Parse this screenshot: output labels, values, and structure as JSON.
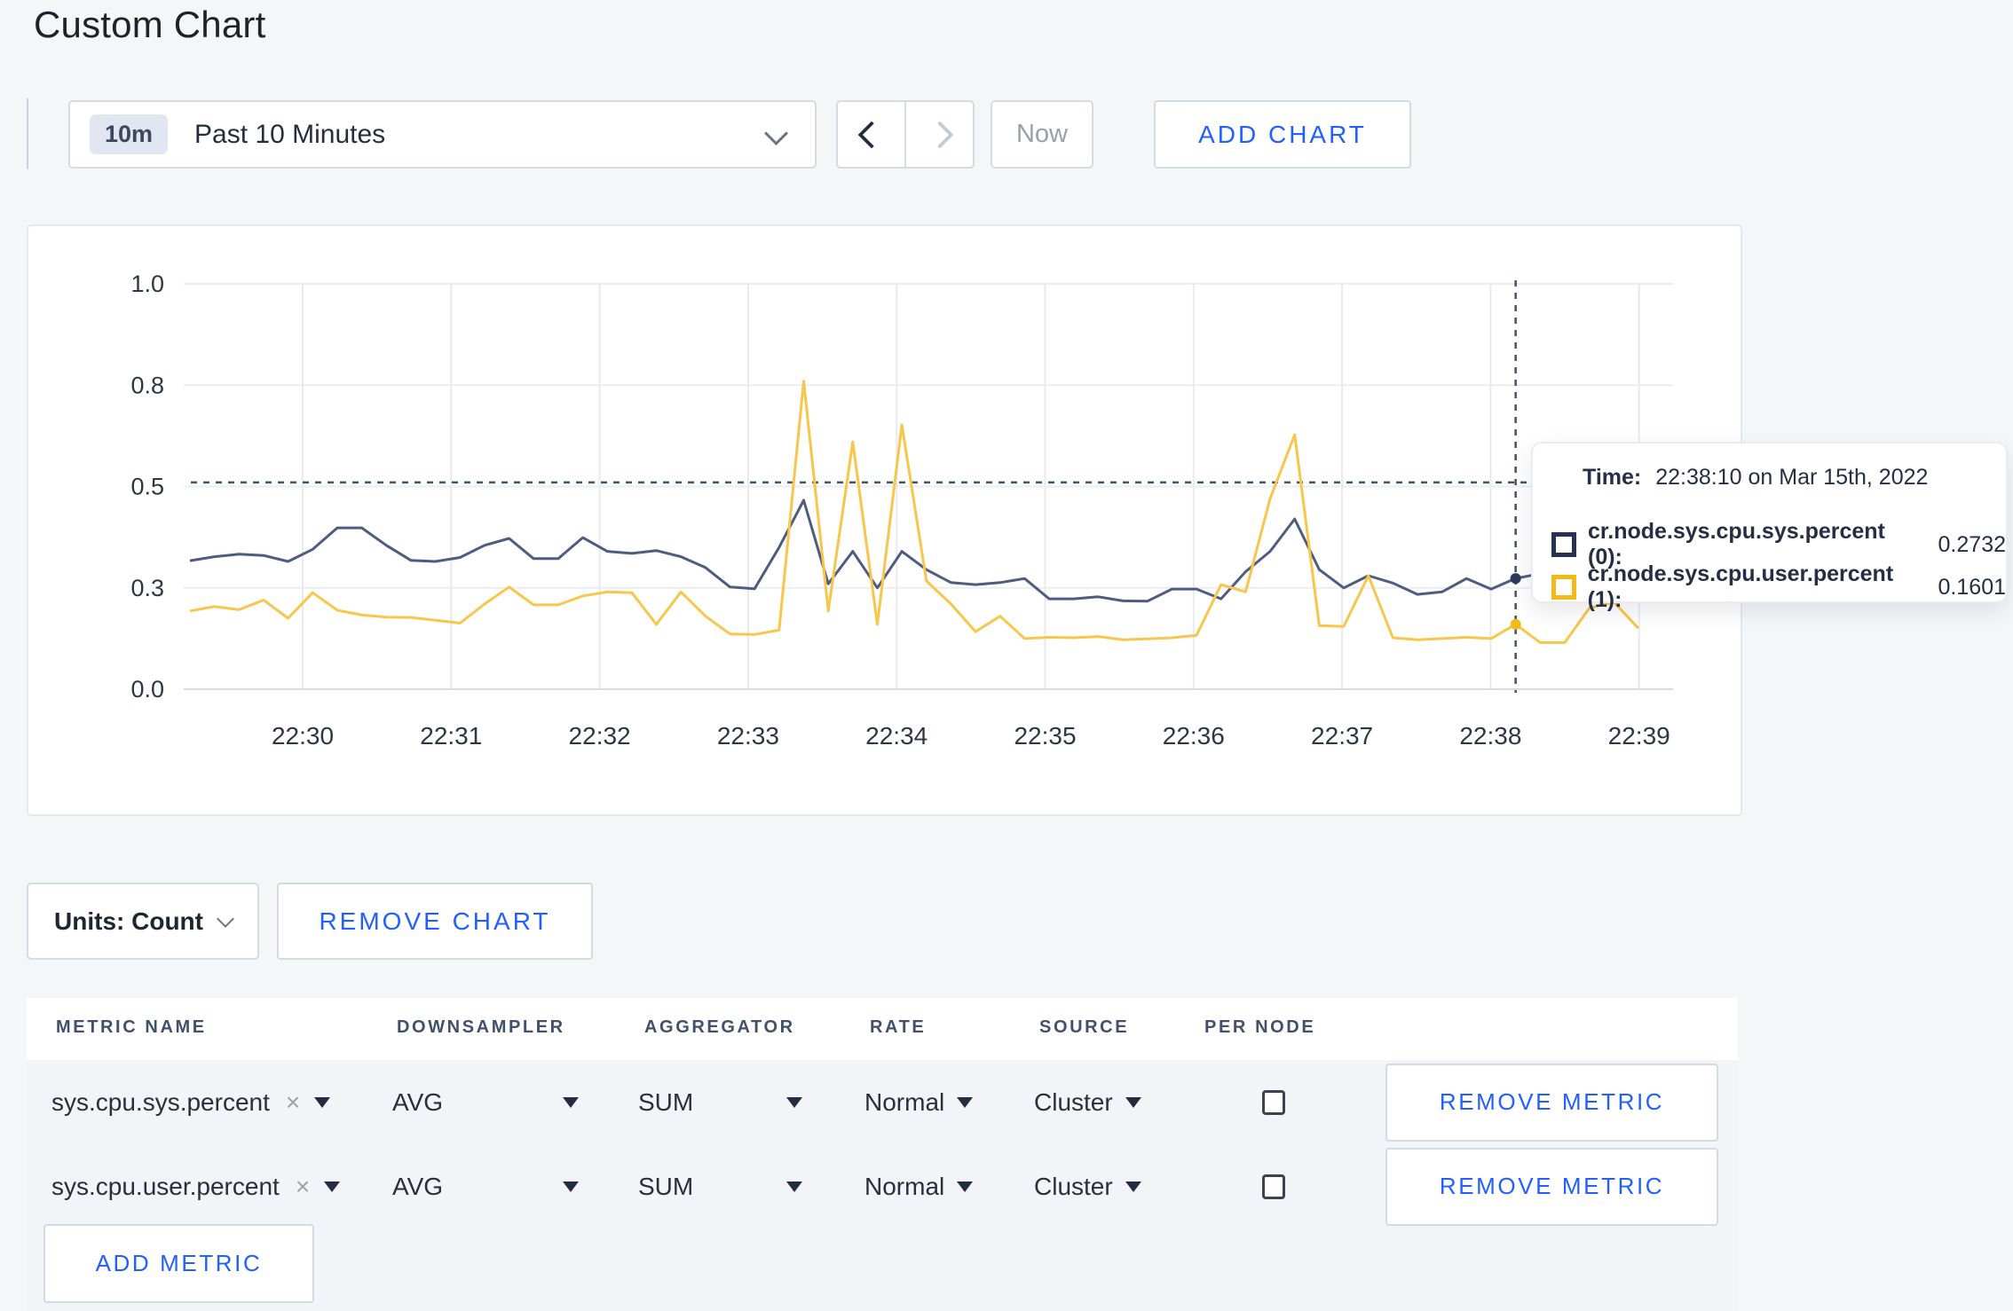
{
  "page": {
    "title": "Custom Chart",
    "accent_blue": "#2160ff",
    "background": "#f5f6f8"
  },
  "toolbar": {
    "time_window_badge": "10m",
    "time_window_label": "Past 10 Minutes",
    "prev_tooltip": "previous time window",
    "next_tooltip": "next time window",
    "now_label": "Now",
    "add_chart_label": "ADD CHART"
  },
  "chart_data": {
    "type": "line",
    "title": "",
    "xlabel": "",
    "ylabel": "",
    "ylim": [
      0,
      1
    ],
    "grid": true,
    "x_start_time": "22:29:10",
    "x_interval_seconds": 10,
    "x_tick_labels": [
      "22:30",
      "22:31",
      "22:32",
      "22:33",
      "22:34",
      "22:35",
      "22:36",
      "22:37",
      "22:38",
      "22:39"
    ],
    "y_ticks": [
      {
        "value": 0.0,
        "label": "0.0"
      },
      {
        "value": 0.25,
        "label": "0.3"
      },
      {
        "value": 0.5,
        "label": "0.5"
      },
      {
        "value": 0.75,
        "label": "0.8"
      },
      {
        "value": 1.0,
        "label": "1.0"
      }
    ],
    "series": [
      {
        "name": "cr.node.sys.cpu.sys.percent (0)",
        "color": "#4d5c80",
        "values": [
          0.317,
          0.327,
          0.333,
          0.33,
          0.315,
          0.345,
          0.398,
          0.398,
          0.355,
          0.318,
          0.315,
          0.325,
          0.355,
          0.372,
          0.322,
          0.322,
          0.374,
          0.34,
          0.335,
          0.342,
          0.327,
          0.3,
          0.252,
          0.248,
          0.35,
          0.466,
          0.26,
          0.34,
          0.25,
          0.34,
          0.295,
          0.263,
          0.258,
          0.263,
          0.273,
          0.223,
          0.223,
          0.228,
          0.218,
          0.217,
          0.247,
          0.247,
          0.223,
          0.29,
          0.34,
          0.42,
          0.295,
          0.25,
          0.28,
          0.262,
          0.234,
          0.24,
          0.273,
          0.247,
          0.2732,
          0.285,
          0.272,
          0.28,
          0.268,
          0.295
        ]
      },
      {
        "name": "cr.node.sys.cpu.user.percent (1)",
        "color": "#f8c64a",
        "values": [
          0.193,
          0.204,
          0.196,
          0.22,
          0.175,
          0.238,
          0.195,
          0.183,
          0.178,
          0.177,
          0.17,
          0.163,
          0.21,
          0.252,
          0.208,
          0.208,
          0.23,
          0.24,
          0.238,
          0.16,
          0.24,
          0.18,
          0.136,
          0.135,
          0.146,
          0.76,
          0.193,
          0.61,
          0.16,
          0.652,
          0.267,
          0.21,
          0.142,
          0.18,
          0.125,
          0.128,
          0.127,
          0.13,
          0.122,
          0.124,
          0.127,
          0.133,
          0.258,
          0.24,
          0.47,
          0.628,
          0.157,
          0.155,
          0.28,
          0.127,
          0.122,
          0.125,
          0.128,
          0.125,
          0.1601,
          0.115,
          0.115,
          0.2,
          0.215,
          0.15
        ]
      }
    ],
    "crosshair": {
      "index": 54,
      "time": "22:38:10",
      "guideline_value": 0.51
    },
    "legend_position": "tooltip"
  },
  "tooltip": {
    "time_label": "Time:",
    "time_value": "22:38:10 on Mar 15th, 2022",
    "rows": [
      {
        "label": "cr.node.sys.cpu.sys.percent (0):",
        "value": "0.2732",
        "color": "#26324f"
      },
      {
        "label": "cr.node.sys.cpu.user.percent (1):",
        "value": "0.1601",
        "color": "#f2ba17"
      }
    ]
  },
  "units_bar": {
    "units_label": "Units: Count",
    "remove_chart_label": "REMOVE CHART"
  },
  "metrics_table": {
    "headers": [
      "METRIC NAME",
      "DOWNSAMPLER",
      "AGGREGATOR",
      "RATE",
      "SOURCE",
      "PER NODE"
    ],
    "rows": [
      {
        "metric_name": "sys.cpu.sys.percent",
        "clear_icon": "×",
        "downsampler": "AVG",
        "aggregator": "SUM",
        "rate": "Normal",
        "source": "Cluster",
        "per_node_checked": false,
        "remove_label": "REMOVE METRIC"
      },
      {
        "metric_name": "sys.cpu.user.percent",
        "clear_icon": "×",
        "downsampler": "AVG",
        "aggregator": "SUM",
        "rate": "Normal",
        "source": "Cluster",
        "per_node_checked": false,
        "remove_label": "REMOVE METRIC"
      }
    ],
    "add_metric_label": "ADD METRIC"
  }
}
